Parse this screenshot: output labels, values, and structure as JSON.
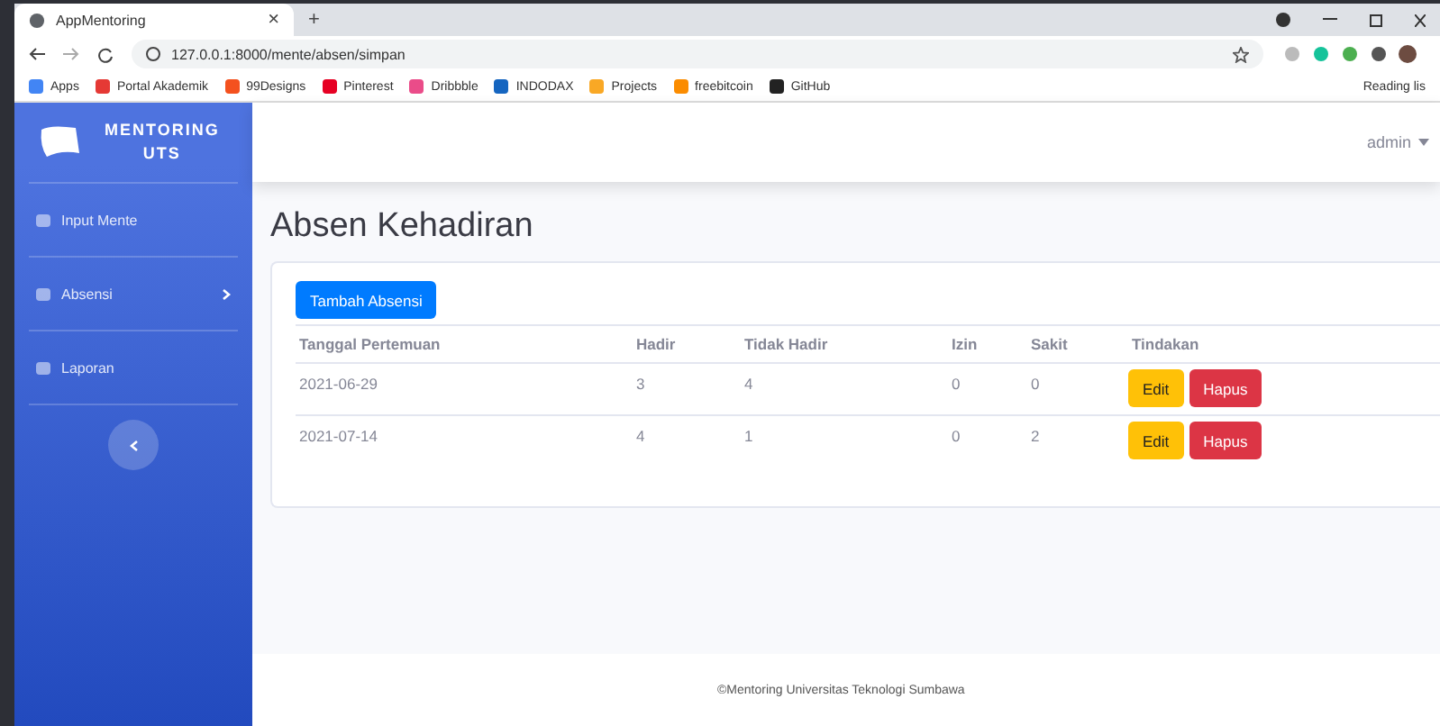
{
  "browser": {
    "tab_title": "AppMentoring",
    "tab_close": "×",
    "new_tab": "+",
    "address": "127.0.0.1:8000/mente/absen/simpan",
    "bookmarks": [
      {
        "label": "Apps",
        "color": "#4285f4"
      },
      {
        "label": "Portal Akademik",
        "color": "#e53935"
      },
      {
        "label": "99Designs",
        "color": "#f4511e"
      },
      {
        "label": "Pinterest",
        "color": "#e60023"
      },
      {
        "label": "Dribbble",
        "color": "#ea4c89"
      },
      {
        "label": "INDODAX",
        "color": "#1565c0"
      },
      {
        "label": "Projects",
        "color": "#f9a825"
      },
      {
        "label": "freebitcoin",
        "color": "#fb8c00"
      },
      {
        "label": "GitHub",
        "color": "#222222"
      }
    ],
    "reading_list": "Reading lis"
  },
  "sidebar": {
    "brand": [
      "MENTORING",
      "UTS"
    ],
    "items": [
      {
        "label": "Input Mente",
        "expandable": false
      },
      {
        "label": "Absensi",
        "expandable": true
      },
      {
        "label": "Laporan",
        "expandable": false
      }
    ]
  },
  "topbar": {
    "user": "admin"
  },
  "page": {
    "title": "Absen Kehadiran",
    "add_button": "Tambah Absensi",
    "table": {
      "columns": [
        "Tanggal Pertemuan",
        "Hadir",
        "Tidak Hadir",
        "Izin",
        "Sakit",
        "Tindakan"
      ],
      "rows": [
        {
          "cells": [
            "2021-06-29",
            "3",
            "4",
            "0",
            "0"
          ],
          "actions": [
            "Edit",
            "Hapus"
          ]
        },
        {
          "cells": [
            "2021-07-14",
            "4",
            "1",
            "0",
            "2"
          ],
          "actions": [
            "Edit",
            "Hapus"
          ]
        }
      ]
    }
  },
  "footer": "©Mentoring Universitas Teknologi Sumbawa"
}
